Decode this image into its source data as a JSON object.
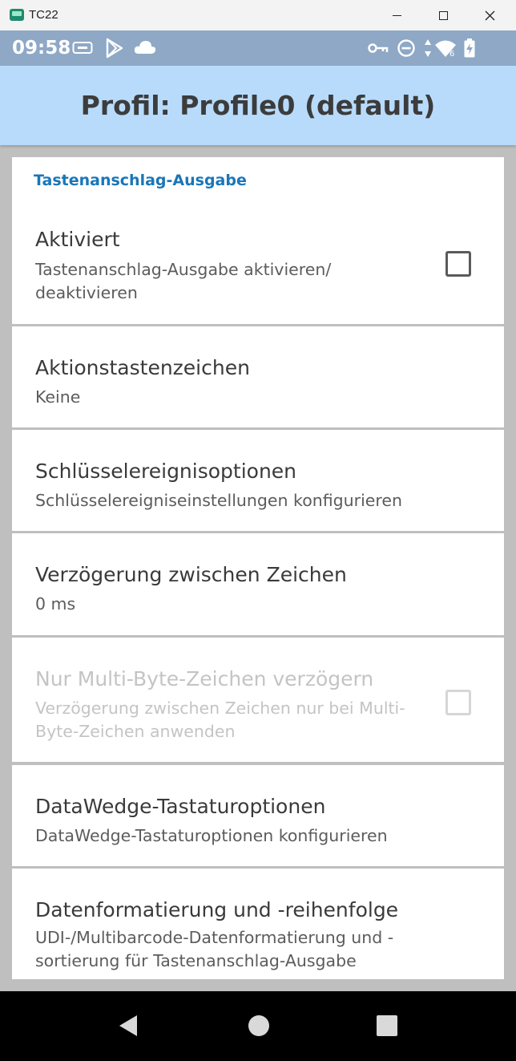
{
  "window": {
    "title": "TC22"
  },
  "status_bar": {
    "time": "09:58",
    "signal_label": "6"
  },
  "app_bar": {
    "title": "Profil: Profile0 (default)"
  },
  "category": {
    "title": "Tastenanschlag-Ausgabe"
  },
  "preferences": [
    {
      "title": "Aktiviert",
      "summary": "Tastenanschlag-Ausgabe aktivieren/ deaktivieren",
      "checkbox": true,
      "checked": false,
      "enabled": true
    },
    {
      "title": "Aktionstastenzeichen",
      "summary": "Keine",
      "checkbox": false,
      "enabled": true
    },
    {
      "title": "Schlüsselereignisoptionen",
      "summary": "Schlüsselereigniseinstellungen konfigurieren",
      "checkbox": false,
      "enabled": true
    },
    {
      "title": "Verzögerung zwischen Zeichen",
      "summary": "0 ms",
      "checkbox": false,
      "enabled": true
    },
    {
      "title": "Nur Multi-Byte-Zeichen verzögern",
      "summary": "Verzögerung zwischen Zeichen nur bei Multi-Byte-Zeichen anwenden",
      "checkbox": true,
      "checked": false,
      "enabled": false
    },
    {
      "title": "DataWedge-Tastaturoptionen",
      "summary": "DataWedge-Tastaturoptionen konfigurieren",
      "checkbox": false,
      "enabled": true
    },
    {
      "title": "Datenformatierung und -reihenfolge",
      "summary": "UDI-/Multibarcode-Datenformatierung und -sortierung für Tastenanschlag-Ausgabe",
      "checkbox": false,
      "enabled": true
    }
  ],
  "icons": {
    "status": [
      "ethernet-icon",
      "play-store-icon",
      "cloud-icon",
      "vpn-key-icon",
      "do-not-disturb-icon",
      "data-arrows-icon",
      "wifi-icon",
      "battery-charging-icon"
    ],
    "nav": [
      "back-icon",
      "home-icon",
      "recents-icon"
    ]
  },
  "colors": {
    "status_bar": "#8ea8c6",
    "app_bar": "#b8dbfb",
    "category_accent": "#1a76b8",
    "nav_bar": "#000000"
  }
}
